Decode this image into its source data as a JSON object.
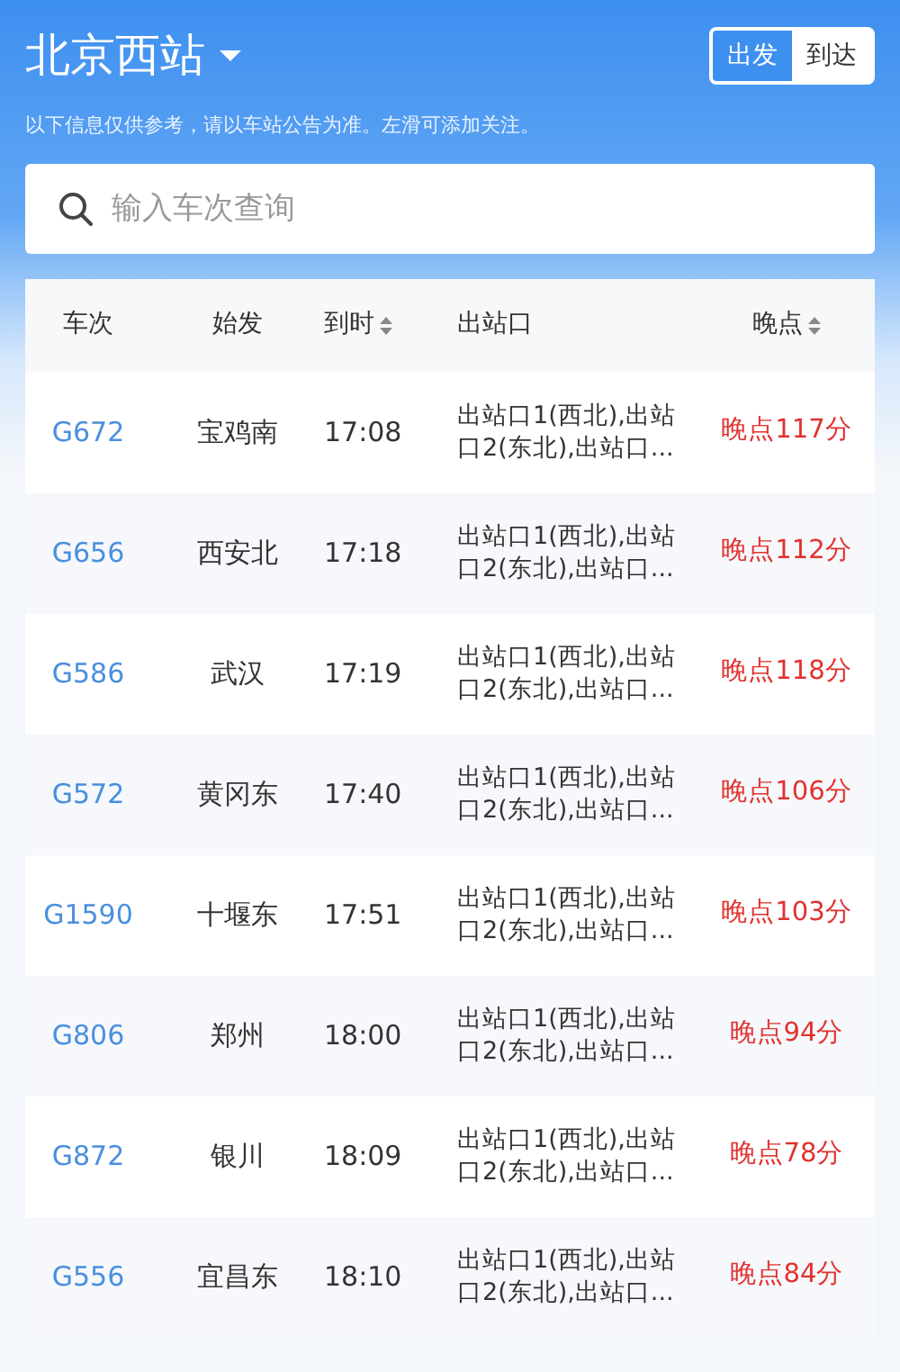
{
  "station": {
    "title": "北京西站"
  },
  "mode_toggle": [
    {
      "label": "出发",
      "selected": true
    },
    {
      "label": "到达",
      "selected": false
    }
  ],
  "notice": "以下信息仅供参考，请以车站公告为准。左滑可添加关注。",
  "search": {
    "placeholder": "输入车次查询"
  },
  "table": {
    "columns": [
      {
        "label": "车次",
        "sortable": false
      },
      {
        "label": "始发",
        "sortable": false
      },
      {
        "label": "到时",
        "sortable": true
      },
      {
        "label": "出站口",
        "sortable": false
      },
      {
        "label": "晚点",
        "sortable": true
      }
    ],
    "rows": [
      {
        "train": "G672",
        "origin": "宝鸡南",
        "arrival": "17:08",
        "exit": "出站口1(西北),出站口2(东北),出站口...",
        "delay": "晚点117分"
      },
      {
        "train": "G656",
        "origin": "西安北",
        "arrival": "17:18",
        "exit": "出站口1(西北),出站口2(东北),出站口...",
        "delay": "晚点112分"
      },
      {
        "train": "G586",
        "origin": "武汉",
        "arrival": "17:19",
        "exit": "出站口1(西北),出站口2(东北),出站口...",
        "delay": "晚点118分"
      },
      {
        "train": "G572",
        "origin": "黄冈东",
        "arrival": "17:40",
        "exit": "出站口1(西北),出站口2(东北),出站口...",
        "delay": "晚点106分"
      },
      {
        "train": "G1590",
        "origin": "十堰东",
        "arrival": "17:51",
        "exit": "出站口1(西北),出站口2(东北),出站口...",
        "delay": "晚点103分"
      },
      {
        "train": "G806",
        "origin": "郑州",
        "arrival": "18:00",
        "exit": "出站口1(西北),出站口2(东北),出站口...",
        "delay": "晚点94分"
      },
      {
        "train": "G872",
        "origin": "银川",
        "arrival": "18:09",
        "exit": "出站口1(西北),出站口2(东北),出站口...",
        "delay": "晚点78分"
      },
      {
        "train": "G556",
        "origin": "宜昌东",
        "arrival": "18:10",
        "exit": "出站口1(西北),出站口2(东北),出站口...",
        "delay": "晚点84分"
      }
    ]
  }
}
